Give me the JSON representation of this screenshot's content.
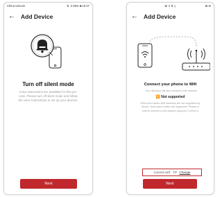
{
  "colors": {
    "accent": "#c0282d",
    "arrow": "#cc2a2e"
  },
  "left_screen": {
    "status": {
      "carrier": "China Unicom",
      "indicators": "⇅ ᐧıl 68% ■ 10:27"
    },
    "header": {
      "back_icon": "←",
      "title": "Add Device"
    },
    "heading": "Turn off silent mode",
    "description": [
      "Voice instructions are available for this pro-",
      "cess. Please turn off silent mode and follow",
      "the voice instructions to set up your devices."
    ],
    "next_label": "Next"
  },
  "right_screen": {
    "status": {
      "center": "⊠ ᐧıl ⇅ ▯",
      "right": "⊠ ⊞"
    },
    "header": {
      "back_icon": "←",
      "title": "Add Device"
    },
    "heading": "Connect your phone to Wifi",
    "subtext": "Your device(s) will also connect to this network",
    "not_supported_label": "Not supported",
    "notes": [
      "5Ghz and hidden Wifi networks are not supported by",
      "device. Dual band routers are supported. Please m",
      "sure to connect a wifi network using the 2.4GHz b"
    ],
    "current_wifi_label": "Current wifi:",
    "current_wifi_value": "TP",
    "change_label": "Change",
    "next_label": "Next"
  }
}
